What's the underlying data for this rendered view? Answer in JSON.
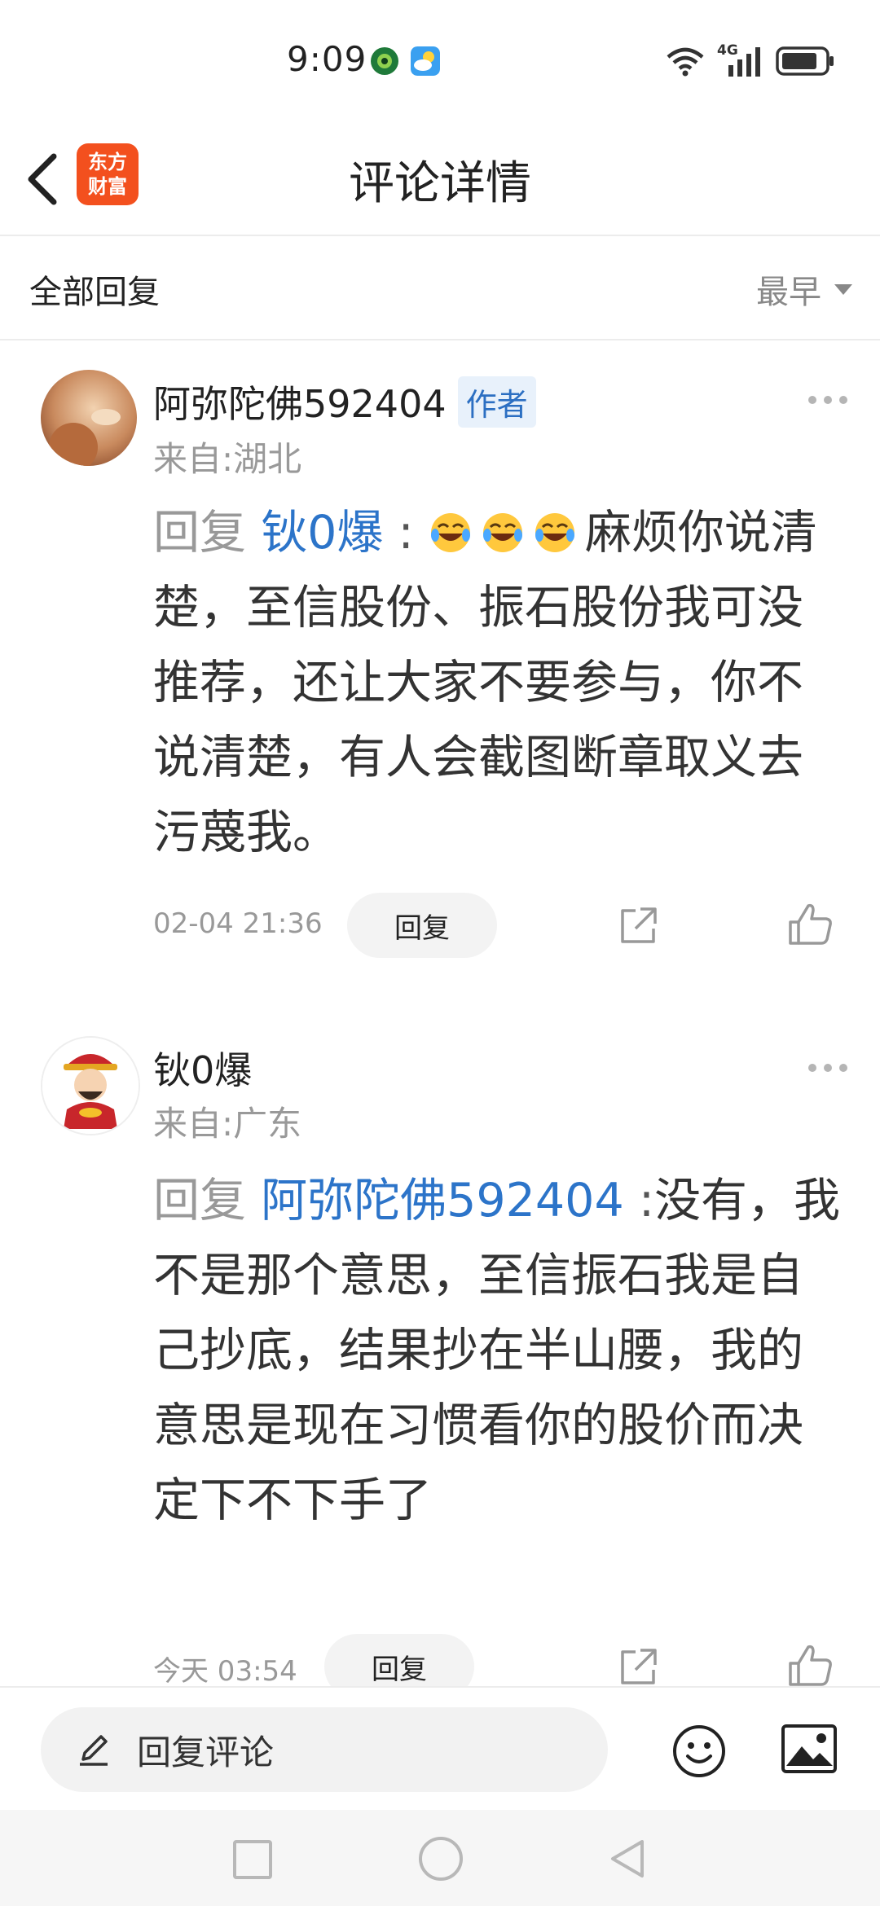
{
  "status_bar": {
    "time": "9:09",
    "network": "4G",
    "icons": [
      "app-notification-icon",
      "weather-icon",
      "wifi-icon",
      "signal-icon",
      "battery-icon"
    ]
  },
  "header": {
    "title": "评论详情",
    "logo_line1": "东方",
    "logo_line2": "财富"
  },
  "filter": {
    "label": "全部回复",
    "sort": "最早"
  },
  "comments": [
    {
      "user": "阿弥陀佛592404",
      "tag": "作者",
      "location": "来自:湖北",
      "reply_prefix": "回复",
      "mention": "钬0爆",
      "colon": ":",
      "emojis": [
        "laughing-crying-emoji",
        "laughing-crying-emoji",
        "laughing-crying-emoji"
      ],
      "text": "麻烦你说清楚，至信股份、振石股份我可没推荐，还让大家不要参与，你不说清楚，有人会截图断章取义去污蔑我。",
      "time": "02-04 21:36",
      "reply_label": "回复"
    },
    {
      "user": "钬0爆",
      "tag": "",
      "location": "来自:广东",
      "reply_prefix": "回复",
      "mention": "阿弥陀佛592404",
      "colon": ":",
      "text": "没有，我不是那个意思，至信振石我是自己抄底，结果抄在半山腰，我的意思是现在习惯看你的股价而决定下不下手了",
      "time": "今天 03:54",
      "reply_label": "回复"
    }
  ],
  "bottom_bar": {
    "placeholder": "回复评论"
  },
  "colors": {
    "accent_blue": "#2c74c9",
    "brand_orange": "#f3501e",
    "muted_gray": "#999999"
  }
}
